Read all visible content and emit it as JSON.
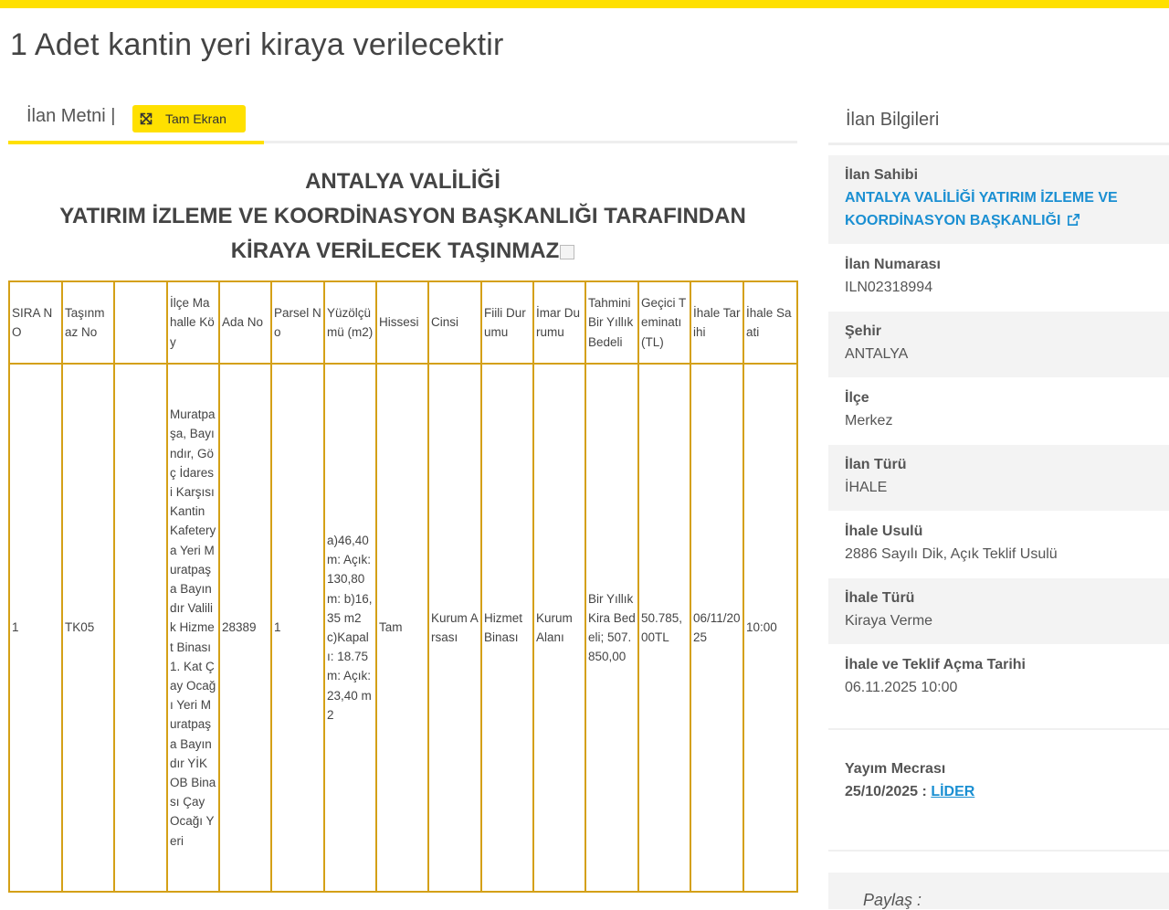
{
  "page": {
    "title": "1 Adet kantin yeri kiraya verilecektir"
  },
  "tabs": {
    "ilan_metni": "İlan Metni |",
    "fullscreen_label": "Tam Ekran"
  },
  "document": {
    "heading_line1": "ANTALYA VALİLİĞİ",
    "heading_line2": "YATIRIM İZLEME VE KOORDİNASYON BAŞKANLIĞI TARAFINDAN",
    "heading_line3": "KİRAYA VERİLECEK TAŞINMAZ",
    "table": {
      "headers": {
        "sira_no": "SIRA NO",
        "tasinmaz_no": "Taşınmaz No",
        "empty": "",
        "ilce_mahalle_koy": "İlçe Mahalle Köy",
        "ada_no": "Ada No",
        "parsel_no": "Parsel No",
        "yuzolcumu": "Yüzölçümü (m2)",
        "hissesi": "Hissesi",
        "cinsi": "Cinsi",
        "fiili_durumu": "Fiili Durumu",
        "imar_durumu": "İmar Durumu",
        "tahmini_bedel": "Tahmini Bir Yıllık Bedeli",
        "gecici_teminat": "Geçici Teminatı (TL)",
        "ihale_tarihi": "İhale Tarihi",
        "ihale_saati": "İhale Saati"
      },
      "row": {
        "sira_no": "1",
        "tasinmaz_no": "TK05",
        "empty": "",
        "ilce_mahalle_koy": "Muratpaşa, Bayındır, Göç İdaresi Karşısı Kantin Kafeterya Yeri Muratpaşa Bayındır Valilik Hizmet Binası 1. Kat Çay Ocağı Yeri Muratpaşa Bayındır YİKOB Binası Çay Ocağı Yeri",
        "ada_no": "28389",
        "parsel_no": "1",
        "yuzolcumu": "a)46,40 m: Açık: 130,80 m: b)16,35 m2 c)Kapalı: 18.75 m: Açık:23,40 m2",
        "hissesi": "Tam",
        "cinsi": "Kurum Arsası",
        "fiili_durumu": "Hizmet Binası",
        "imar_durumu": "Kurum Alanı",
        "tahmini_bedel": "Bir Yıllık Kira Bedeli; 507.850,00",
        "gecici_teminat": "50.785,00TL",
        "ihale_tarihi": "06/11/2025",
        "ihale_saati": "10:00"
      }
    }
  },
  "sidebar": {
    "title": "İlan Bilgileri",
    "ilan_sahibi": {
      "label": "İlan Sahibi",
      "value_line1": "ANTALYA VALİLİĞİ YATIRIM İZLEME VE",
      "value_line2": "KOORDİNASYON BAŞKANLIĞI"
    },
    "ilan_numarasi": {
      "label": "İlan Numarası",
      "value": "ILN02318994"
    },
    "sehir": {
      "label": "Şehir",
      "value": "ANTALYA"
    },
    "ilce": {
      "label": "İlçe",
      "value": "Merkez"
    },
    "ilan_turu": {
      "label": "İlan Türü",
      "value": "İHALE"
    },
    "ihale_usulu": {
      "label": "İhale Usulü",
      "value": "2886 Sayılı Dik, Açık Teklif Usulü"
    },
    "ihale_turu": {
      "label": "İhale Türü",
      "value": "Kiraya Verme"
    },
    "ihale_tarihi": {
      "label": "İhale ve Teklif Açma Tarihi",
      "value": "06.11.2025 10:00"
    },
    "yayim_mecrasi": {
      "label": "Yayım Mecrası",
      "date": "25/10/2025 :",
      "link": "LİDER"
    },
    "paylas": "Paylaş :"
  },
  "colors": {
    "accent_yellow": "#ffe000",
    "table_border": "#d4a017",
    "link_blue": "#1a8fd2"
  },
  "icons": {
    "fullscreen": "expand-arrows-icon",
    "external_link": "external-link-icon"
  }
}
